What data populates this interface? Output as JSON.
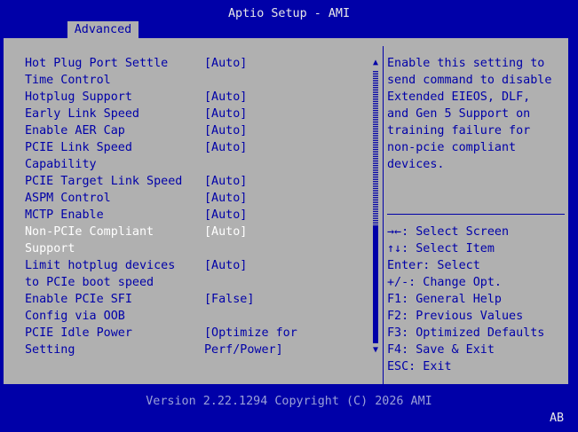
{
  "header": {
    "title": "Aptio Setup - AMI",
    "tabs": [
      {
        "label": "Advanced",
        "active": true
      }
    ]
  },
  "settings": [
    {
      "label_lines": [
        "Hot Plug Port Settle",
        "Time Control"
      ],
      "value_lines": [
        "[Auto]"
      ],
      "selected": false
    },
    {
      "label_lines": [
        "Hotplug Support"
      ],
      "value_lines": [
        "[Auto]"
      ],
      "selected": false
    },
    {
      "label_lines": [
        "Early Link Speed"
      ],
      "value_lines": [
        "[Auto]"
      ],
      "selected": false
    },
    {
      "label_lines": [
        "Enable AER Cap"
      ],
      "value_lines": [
        "[Auto]"
      ],
      "selected": false
    },
    {
      "label_lines": [
        "PCIE Link Speed",
        "Capability"
      ],
      "value_lines": [
        "[Auto]"
      ],
      "selected": false
    },
    {
      "label_lines": [
        "PCIE Target Link Speed"
      ],
      "value_lines": [
        "[Auto]"
      ],
      "selected": false
    },
    {
      "label_lines": [
        "ASPM Control"
      ],
      "value_lines": [
        "[Auto]"
      ],
      "selected": false
    },
    {
      "label_lines": [
        "MCTP Enable"
      ],
      "value_lines": [
        "[Auto]"
      ],
      "selected": false
    },
    {
      "label_lines": [
        "Non-PCIe Compliant",
        "Support"
      ],
      "value_lines": [
        "[Auto]"
      ],
      "selected": true
    },
    {
      "label_lines": [
        "Limit hotplug devices",
        "to PCIe boot speed"
      ],
      "value_lines": [
        "[Auto]"
      ],
      "selected": false
    },
    {
      "label_lines": [
        "Enable PCIe SFI",
        "Config via OOB"
      ],
      "value_lines": [
        "[False]"
      ],
      "selected": false
    },
    {
      "label_lines": [
        "PCIE Idle Power",
        "Setting"
      ],
      "value_lines": [
        "[Optimize for",
        "Perf/Power]"
      ],
      "selected": false
    }
  ],
  "scrollbar": {
    "up_arrow": "▲",
    "down_arrow": "▼",
    "position": 0.8
  },
  "help": {
    "lines": [
      "Enable this setting to",
      "send command to disable",
      "Extended EIEOS, DLF,",
      "and Gen 5 Support on",
      "training failure for",
      "non-pcie compliant",
      "devices."
    ]
  },
  "keys": [
    "→←: Select Screen",
    "↑↓: Select Item",
    "Enter: Select",
    "+/-: Change Opt.",
    "F1: General Help",
    "F2: Previous Values",
    "F3: Optimized Defaults",
    "F4: Save & Exit",
    "ESC: Exit"
  ],
  "footer": {
    "version": "Version 2.22.1294 Copyright (C) 2026 AMI",
    "corner": "AB"
  },
  "colors": {
    "background": "#0000a8",
    "panel": "#b0b0b0",
    "text": "#0000a8",
    "selected_text": "#ffffff"
  }
}
